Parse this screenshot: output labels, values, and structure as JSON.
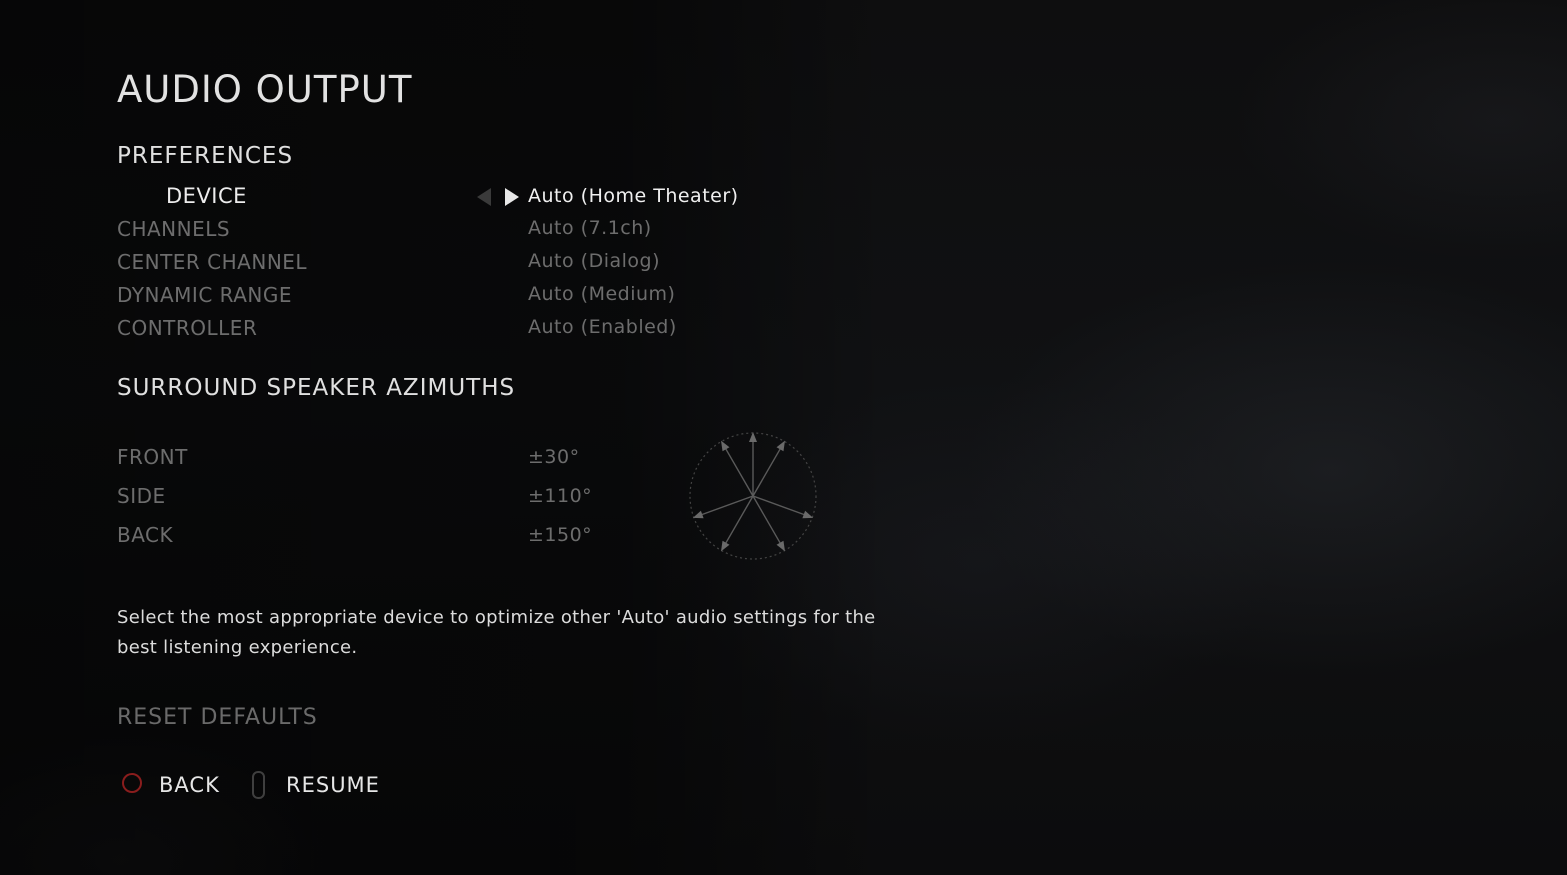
{
  "title": "AUDIO OUTPUT",
  "preferences": {
    "header": "PREFERENCES",
    "rows": [
      {
        "label": "DEVICE",
        "value": "Auto (Home Theater)"
      },
      {
        "label": "CHANNELS",
        "value": "Auto (7.1ch)"
      },
      {
        "label": "CENTER CHANNEL",
        "value": "Auto (Dialog)"
      },
      {
        "label": "DYNAMIC RANGE",
        "value": "Auto (Medium)"
      },
      {
        "label": "CONTROLLER",
        "value": "Auto (Enabled)"
      }
    ]
  },
  "azimuths": {
    "header": "SURROUND SPEAKER AZIMUTHS",
    "rows": [
      {
        "label": "FRONT",
        "value": "±30°"
      },
      {
        "label": "SIDE",
        "value": "±110°"
      },
      {
        "label": "BACK",
        "value": "±150°"
      }
    ],
    "angles_deg": [
      0,
      30,
      -30,
      110,
      -110,
      150,
      -150
    ]
  },
  "description": "Select the most appropriate device to optimize other 'Auto' audio settings for the best listening experience.",
  "reset_label": "RESET DEFAULTS",
  "footer": {
    "back_label": "BACK",
    "resume_label": "RESUME",
    "back_button_icon": "circle-button-icon",
    "resume_button_icon": "touchpad-button-icon"
  },
  "colors": {
    "selected_text": "#f0f0f0",
    "dim_text": "#6d6d6d",
    "back_button": "#8a1d1d"
  }
}
